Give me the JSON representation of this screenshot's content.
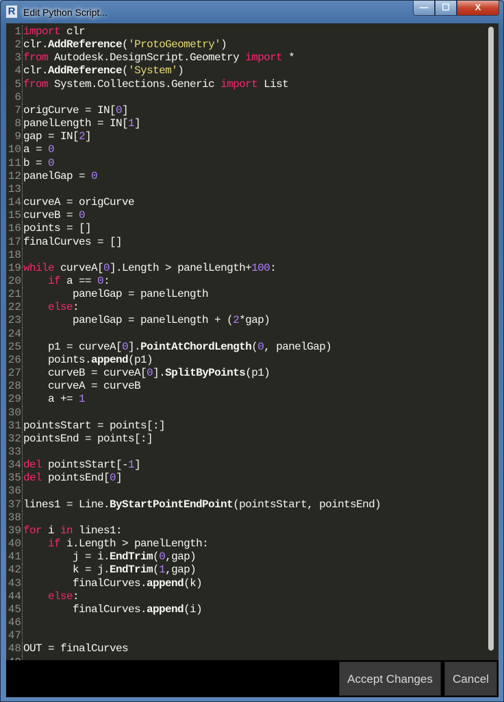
{
  "window": {
    "title": "Edit Python Script...",
    "app_icon": "R",
    "minimize": "—",
    "maximize": "☐",
    "close": "X"
  },
  "buttons": {
    "accept": "Accept Changes",
    "cancel": "Cancel"
  },
  "code": [
    [
      [
        "kw",
        "import"
      ],
      [
        "t",
        " clr"
      ]
    ],
    [
      [
        "t",
        "clr."
      ],
      [
        "fn",
        "AddReference"
      ],
      [
        "t",
        "("
      ],
      [
        "str",
        "'ProtoGeometry'"
      ],
      [
        "t",
        ")"
      ]
    ],
    [
      [
        "kw",
        "from"
      ],
      [
        "t",
        " Autodesk.DesignScript.Geometry "
      ],
      [
        "kw",
        "import"
      ],
      [
        "t",
        " *"
      ]
    ],
    [
      [
        "t",
        "clr."
      ],
      [
        "fn",
        "AddReference"
      ],
      [
        "t",
        "("
      ],
      [
        "str",
        "'System'"
      ],
      [
        "t",
        ")"
      ]
    ],
    [
      [
        "kw",
        "from"
      ],
      [
        "t",
        " System.Collections.Generic "
      ],
      [
        "kw",
        "import"
      ],
      [
        "t",
        " List"
      ]
    ],
    [],
    [
      [
        "t",
        "origCurve = IN["
      ],
      [
        "nm",
        "0"
      ],
      [
        "t",
        "]"
      ]
    ],
    [
      [
        "t",
        "panelLength = IN["
      ],
      [
        "nm",
        "1"
      ],
      [
        "t",
        "]"
      ]
    ],
    [
      [
        "t",
        "gap = IN["
      ],
      [
        "nm",
        "2"
      ],
      [
        "t",
        "]"
      ]
    ],
    [
      [
        "t",
        "a = "
      ],
      [
        "nm",
        "0"
      ]
    ],
    [
      [
        "t",
        "b = "
      ],
      [
        "nm",
        "0"
      ]
    ],
    [
      [
        "t",
        "panelGap = "
      ],
      [
        "nm",
        "0"
      ]
    ],
    [],
    [
      [
        "t",
        "curveA = origCurve"
      ]
    ],
    [
      [
        "t",
        "curveB = "
      ],
      [
        "nm",
        "0"
      ]
    ],
    [
      [
        "t",
        "points = []"
      ]
    ],
    [
      [
        "t",
        "finalCurves = []"
      ]
    ],
    [],
    [
      [
        "kw",
        "while"
      ],
      [
        "t",
        " curveA["
      ],
      [
        "nm",
        "0"
      ],
      [
        "t",
        "].Length > panelLength+"
      ],
      [
        "nm",
        "100"
      ],
      [
        "t",
        ":"
      ]
    ],
    [
      [
        "t",
        "    "
      ],
      [
        "kw",
        "if"
      ],
      [
        "t",
        " a == "
      ],
      [
        "nm",
        "0"
      ],
      [
        "t",
        ":"
      ]
    ],
    [
      [
        "t",
        "        panelGap = panelLength"
      ]
    ],
    [
      [
        "t",
        "    "
      ],
      [
        "kw",
        "else"
      ],
      [
        "t",
        ":"
      ]
    ],
    [
      [
        "t",
        "        panelGap = panelLength + ("
      ],
      [
        "nm",
        "2"
      ],
      [
        "t",
        "*gap)"
      ]
    ],
    [],
    [
      [
        "t",
        "    p1 = curveA["
      ],
      [
        "nm",
        "0"
      ],
      [
        "t",
        "]."
      ],
      [
        "fn",
        "PointAtChordLength"
      ],
      [
        "t",
        "("
      ],
      [
        "nm",
        "0"
      ],
      [
        "t",
        ", panelGap)"
      ]
    ],
    [
      [
        "t",
        "    points."
      ],
      [
        "fn",
        "append"
      ],
      [
        "t",
        "(p1)"
      ]
    ],
    [
      [
        "t",
        "    curveB = curveA["
      ],
      [
        "nm",
        "0"
      ],
      [
        "t",
        "]."
      ],
      [
        "fn",
        "SplitByPoints"
      ],
      [
        "t",
        "(p1)"
      ]
    ],
    [
      [
        "t",
        "    curveA = curveB"
      ]
    ],
    [
      [
        "t",
        "    a += "
      ],
      [
        "nm",
        "1"
      ]
    ],
    [],
    [
      [
        "t",
        "pointsStart = points[:]"
      ]
    ],
    [
      [
        "t",
        "pointsEnd = points[:]"
      ]
    ],
    [],
    [
      [
        "kw",
        "del"
      ],
      [
        "t",
        " pointsStart[-"
      ],
      [
        "nm",
        "1"
      ],
      [
        "t",
        "]"
      ]
    ],
    [
      [
        "kw",
        "del"
      ],
      [
        "t",
        " pointsEnd["
      ],
      [
        "nm",
        "0"
      ],
      [
        "t",
        "]"
      ]
    ],
    [],
    [
      [
        "t",
        "lines1 = Line."
      ],
      [
        "fn",
        "ByStartPointEndPoint"
      ],
      [
        "t",
        "(pointsStart, pointsEnd)"
      ]
    ],
    [],
    [
      [
        "kw",
        "for"
      ],
      [
        "t",
        " i "
      ],
      [
        "kw",
        "in"
      ],
      [
        "t",
        " lines1:"
      ]
    ],
    [
      [
        "t",
        "    "
      ],
      [
        "kw",
        "if"
      ],
      [
        "t",
        " i.Length > panelLength:"
      ]
    ],
    [
      [
        "t",
        "        j = i."
      ],
      [
        "fn",
        "EndTrim"
      ],
      [
        "t",
        "("
      ],
      [
        "nm",
        "0"
      ],
      [
        "t",
        ",gap)"
      ]
    ],
    [
      [
        "t",
        "        k = j."
      ],
      [
        "fn",
        "EndTrim"
      ],
      [
        "t",
        "("
      ],
      [
        "nm",
        "1"
      ],
      [
        "t",
        ",gap)"
      ]
    ],
    [
      [
        "t",
        "        finalCurves."
      ],
      [
        "fn",
        "append"
      ],
      [
        "t",
        "(k)"
      ]
    ],
    [
      [
        "t",
        "    "
      ],
      [
        "kw",
        "else"
      ],
      [
        "t",
        ":"
      ]
    ],
    [
      [
        "t",
        "        finalCurves."
      ],
      [
        "fn",
        "append"
      ],
      [
        "t",
        "(i)"
      ]
    ],
    [],
    [],
    [
      [
        "t",
        "OUT = finalCurves"
      ]
    ],
    []
  ]
}
